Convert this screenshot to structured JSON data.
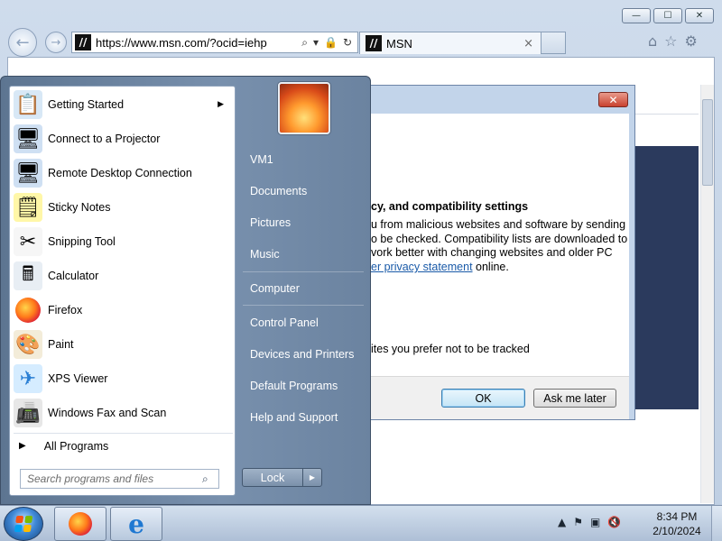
{
  "browser": {
    "address_url": "https://www.msn.com/?ocid=iehp",
    "site_badge": "//",
    "tab_title": "MSN",
    "tab_close": "×",
    "window_controls": {
      "minimize": "—",
      "maximize": "☐",
      "close": "✕"
    },
    "nav": {
      "back": "←",
      "forward": "→"
    },
    "address_icons": {
      "search": "⌕",
      "dropdown": "▾",
      "lock": "🔒",
      "refresh": "↻"
    },
    "tools": {
      "home": "⌂",
      "favorites": "☆",
      "settings": "⚙"
    }
  },
  "dialog": {
    "close_glyph": "✕",
    "heading": "cy, and compatibility settings",
    "lines": [
      "u from malicious websites and software by sending",
      "o be checked. Compatibility lists are downloaded to",
      "vork better with changing websites and older PC"
    ],
    "link_text": "er privacy statement",
    "link_after": " online.",
    "tracking_text": "ites you prefer not to be tracked",
    "ok_label": "OK",
    "ask_later_label": "Ask me later"
  },
  "start_menu": {
    "programs": [
      {
        "label": "Getting Started",
        "icon": "getting-started-icon",
        "glyph": "📋",
        "has_submenu": true
      },
      {
        "label": "Connect to a Projector",
        "icon": "projector-icon",
        "glyph": "🖥"
      },
      {
        "label": "Remote Desktop Connection",
        "icon": "remote-desktop-icon",
        "glyph": "🖥"
      },
      {
        "label": "Sticky Notes",
        "icon": "sticky-notes-icon",
        "glyph": "🗒"
      },
      {
        "label": "Snipping Tool",
        "icon": "scissors-icon",
        "glyph": "✂"
      },
      {
        "label": "Calculator",
        "icon": "calculator-icon",
        "glyph": "🖩"
      },
      {
        "label": "Firefox",
        "icon": "firefox-icon",
        "glyph": ""
      },
      {
        "label": "Paint",
        "icon": "paint-icon",
        "glyph": "🎨"
      },
      {
        "label": "XPS Viewer",
        "icon": "xps-viewer-icon",
        "glyph": "✈"
      },
      {
        "label": "Windows Fax and Scan",
        "icon": "fax-icon",
        "glyph": "📠"
      }
    ],
    "all_programs": "All Programs",
    "search_placeholder": "Search programs and files",
    "places": [
      "VM1",
      "Documents",
      "Pictures",
      "Music",
      "Computer",
      "Control Panel",
      "Devices and Printers",
      "Default Programs",
      "Help and Support"
    ],
    "lock_label": "Lock",
    "lock_arrow": "▶"
  },
  "taskbar": {
    "time": "8:34 PM",
    "date": "2/10/2024",
    "tray_icons": [
      "▲",
      "⚑",
      "▣",
      "🔇"
    ]
  },
  "colors": {
    "flag_red": "#f65314",
    "flag_green": "#7cbb00",
    "flag_blue": "#00a1f1",
    "flag_yellow": "#ffbb00",
    "program_icon_bgs": [
      "#d8e8f6",
      "#cfe0f3",
      "#cfe0f3",
      "#fff7a8",
      "#f6f6f6",
      "#e8eef4",
      "#ff7a1a",
      "#f3ecd9",
      "#d5ecff",
      "#e7e7e7"
    ]
  }
}
